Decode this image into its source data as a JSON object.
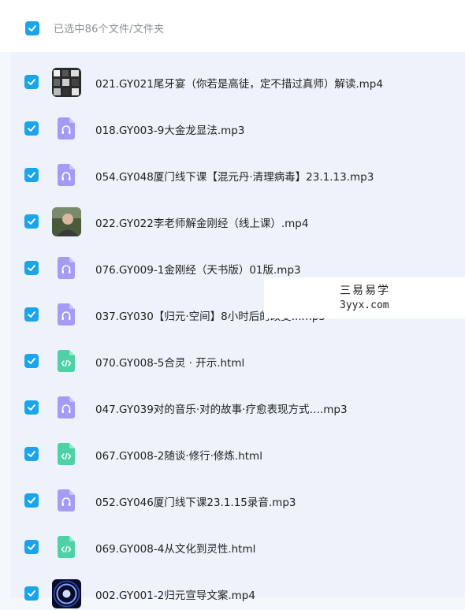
{
  "header": {
    "select_all_checked": true,
    "title": "已选中86个文件/文件夹"
  },
  "files": [
    {
      "name": "021.GY021尾牙宴（你若是高徒，定不措过真师）解读.mp4",
      "type": "video",
      "checked": true
    },
    {
      "name": "018.GY003-9大金龙显法.mp3",
      "type": "audio",
      "checked": true
    },
    {
      "name": "054.GY048厦门线下课【混元丹·清理病毒】23.1.13.mp3",
      "type": "audio",
      "checked": true
    },
    {
      "name": "022.GY022李老师解金刚经（线上课）.mp4",
      "type": "video",
      "checked": true
    },
    {
      "name": "076.GY009-1金刚经（天书版）01版.mp3",
      "type": "audio",
      "checked": true
    },
    {
      "name": "037.GY030【归元·空间】8小时后的改变...mp3",
      "type": "audio",
      "checked": true
    },
    {
      "name": "070.GY008-5合灵 · 开示.html",
      "type": "html",
      "checked": true
    },
    {
      "name": "047.GY039对的音乐·对的故事·疗愈表现方式….mp3",
      "type": "audio",
      "checked": true
    },
    {
      "name": "067.GY008-2随谈·修行·修炼.html",
      "type": "html",
      "checked": true
    },
    {
      "name": "052.GY046厦门线下课23.1.15录音.mp3",
      "type": "audio",
      "checked": true
    },
    {
      "name": "069.GY008-4从文化到灵性.html",
      "type": "html",
      "checked": true
    },
    {
      "name": "002.GY001-2归元宣导文案.mp4",
      "type": "video",
      "checked": true
    }
  ],
  "watermark": {
    "line1": "三易易学",
    "line2": "3yyx.com"
  },
  "colors": {
    "checkbox": "#1aa5ea",
    "audio_icon": "#a49cf2",
    "html_icon": "#4fd1a6",
    "list_bg": "#eef3fb"
  }
}
